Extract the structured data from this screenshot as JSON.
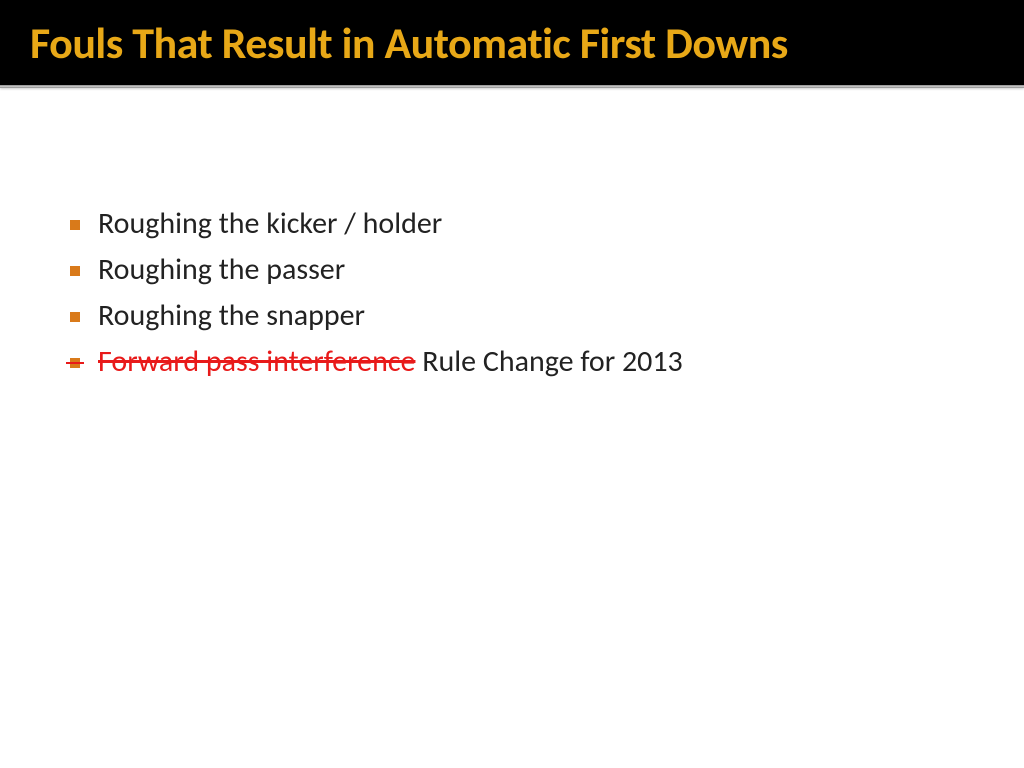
{
  "title": "Fouls That Result in Automatic First Downs",
  "bullets": [
    {
      "text": "Roughing the kicker / holder",
      "struck": false
    },
    {
      "text": "Roughing the passer",
      "struck": false
    },
    {
      "text": "Roughing the snapper",
      "struck": false
    }
  ],
  "changed_item": {
    "struck_text": "Forward pass interference",
    "suffix_text": " Rule Change for 2013"
  }
}
